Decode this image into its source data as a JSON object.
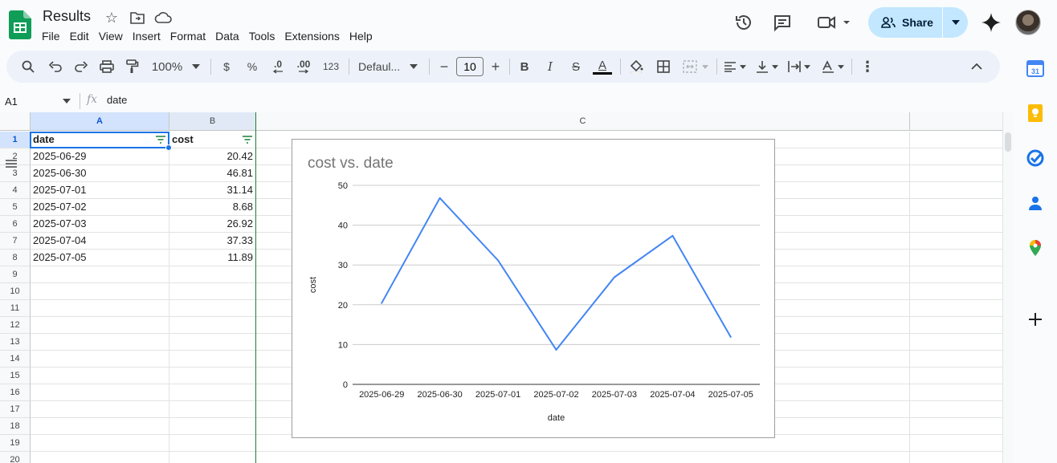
{
  "app": {
    "title": "Results",
    "menu": [
      "File",
      "Edit",
      "View",
      "Insert",
      "Format",
      "Data",
      "Tools",
      "Extensions",
      "Help"
    ],
    "share_label": "Share"
  },
  "toolbar": {
    "zoom": "100%",
    "currency": "$",
    "percent": "%",
    "dec_decrease": ".0",
    "dec_increase": ".00",
    "number_format": "123",
    "font": "Defaul...",
    "font_size": "10",
    "bold": "B",
    "italic": "I",
    "strike": "S",
    "text_color_glyph": "A",
    "text_color": "#000000"
  },
  "formula_bar": {
    "cell_ref": "A1",
    "fx": "fx",
    "content": "date"
  },
  "sheet": {
    "columns": [
      "A",
      "B",
      "C"
    ],
    "rows": [
      "1",
      "2",
      "3",
      "4",
      "5",
      "6",
      "7",
      "8",
      "9",
      "10",
      "11",
      "12",
      "13",
      "14",
      "15",
      "16",
      "17",
      "18",
      "19",
      "20"
    ],
    "header": [
      "date",
      "cost"
    ],
    "data": [
      [
        "2025-06-29",
        "20.42"
      ],
      [
        "2025-06-30",
        "46.81"
      ],
      [
        "2025-07-01",
        "31.14"
      ],
      [
        "2025-07-02",
        "8.68"
      ],
      [
        "2025-07-03",
        "26.92"
      ],
      [
        "2025-07-04",
        "37.33"
      ],
      [
        "2025-07-05",
        "11.89"
      ]
    ]
  },
  "chart_data": {
    "type": "line",
    "title": "cost vs. date",
    "xlabel": "date",
    "ylabel": "cost",
    "categories": [
      "2025-06-29",
      "2025-06-30",
      "2025-07-01",
      "2025-07-02",
      "2025-07-03",
      "2025-07-04",
      "2025-07-05"
    ],
    "series": [
      {
        "values": [
          20.42,
          46.81,
          31.14,
          8.68,
          26.92,
          37.33,
          11.89
        ],
        "color": "#4285f4"
      }
    ],
    "ylim": [
      0,
      50
    ],
    "yticks": [
      "0",
      "10",
      "20",
      "30",
      "40",
      "50"
    ],
    "grid": true,
    "legend": "none"
  },
  "colors": {
    "accent": "#1a73e8",
    "share_bg": "#c2e7ff",
    "freeze_line": "#188038",
    "selection_header": "#d3e3fd"
  }
}
